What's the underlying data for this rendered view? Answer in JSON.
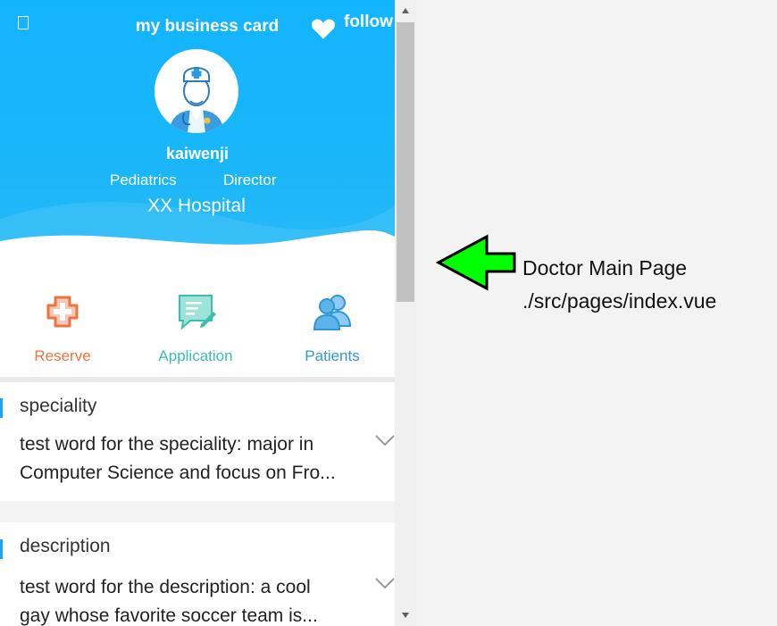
{
  "header": {
    "title": "my business card",
    "follow_label": "follow",
    "name": "kaiwenji",
    "department": "Pediatrics",
    "position": "Director",
    "hospital": "XX Hospital"
  },
  "menu": {
    "reserve_label": "Reserve",
    "application_label": "Application",
    "patients_label": "Patients"
  },
  "sections": {
    "speciality": {
      "title": "speciality",
      "text_line1": "test word for the speciality: major in",
      "text_line2": "Computer Science and focus on Fro..."
    },
    "description": {
      "title": "description",
      "text_line1": "test word for the description: a cool",
      "text_line2": "gay whose favorite soccer team is..."
    }
  },
  "annotation": {
    "line1": "Doctor Main Page",
    "line2": "./src/pages/index.vue"
  },
  "colors": {
    "header_blue": "#19b6f9",
    "reserve": "#e8743f",
    "application": "#3bbdb0",
    "patients": "#2f97d6",
    "accent_bar": "#1ea3f1",
    "arrow_green": "#00ff00"
  },
  "icons": {
    "back": "back-icon",
    "follow": "heart-icon",
    "avatar": "doctor-avatar",
    "reserve": "medical-cross-icon",
    "application": "chat-note-icon",
    "patients": "patients-icon",
    "expand": "chevron-down-icon",
    "pointer": "green-arrow-icon"
  }
}
